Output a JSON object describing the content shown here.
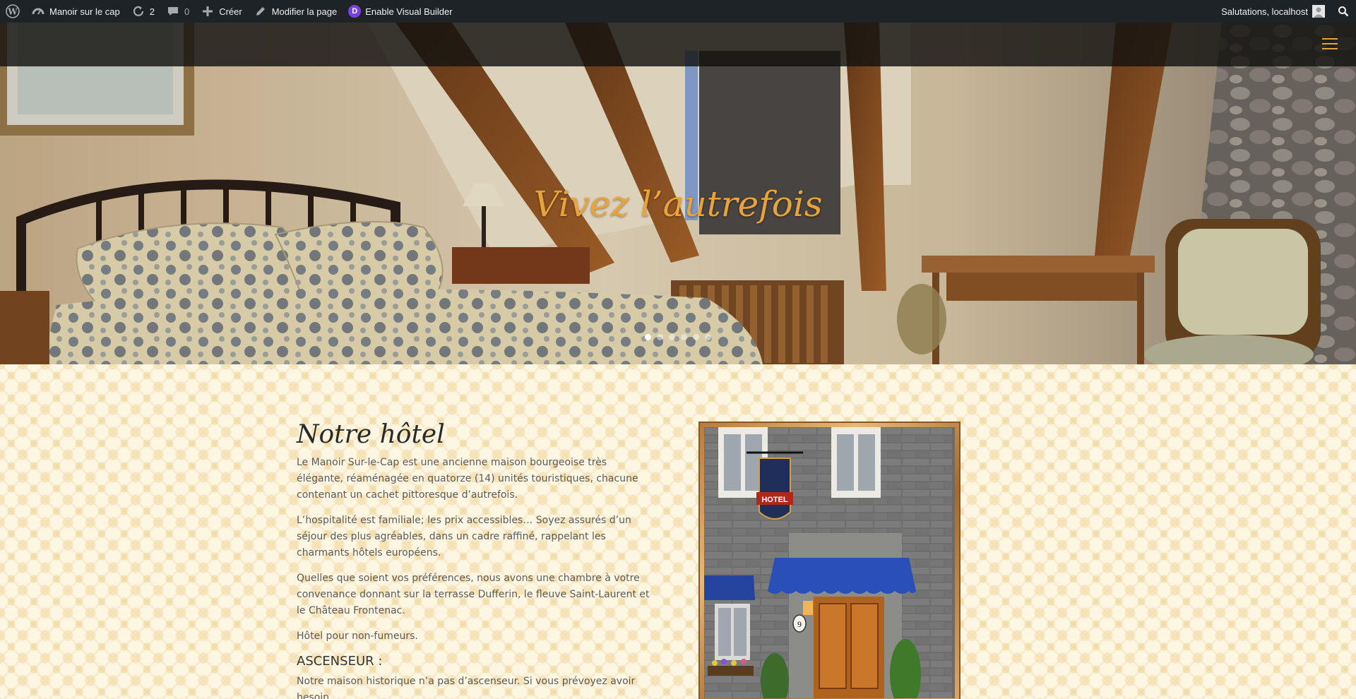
{
  "admin_bar": {
    "site_name": "Manoir sur le cap",
    "updates_count": "2",
    "comments_count": "0",
    "new_label": "Créer",
    "edit_label": "Modifier la page",
    "visual_builder_label": "Enable Visual Builder",
    "greeting": "Salutations, localhost"
  },
  "hero": {
    "title": "Vivez l’autrefois",
    "slides_total": 6,
    "active_slide": 1
  },
  "main": {
    "heading": "Notre hôtel",
    "paragraphs": [
      "Le Manoir Sur-le-Cap est une ancienne maison bourgeoise très élégante, réaménagée en quatorze (14) unités touristiques, chacune contenant un cachet pittoresque d’autrefois.",
      "L’hospitalité est familiale; les prix accessibles… Soyez assurés d’un séjour des plus agréables, dans un cadre raffiné, rappelant les charmants hôtels européens.",
      "Quelles que soient vos préférences, nous avons une chambre à votre convenance donnant sur la terrasse Dufferin, le fleuve Saint-Laurent et le Château Frontenac.",
      "Hôtel pour non-fumeurs."
    ],
    "subheading": "ASCENSEUR :",
    "last_paragraph": "Notre maison historique n’a pas d’ascenseur. Si vous prévoyez avoir besoin",
    "photo": {
      "sign_text": "HOTEL",
      "door_number": "9"
    }
  },
  "colors": {
    "admin_bar_bg": "#1d2327",
    "accent_gold": "#e9a33b",
    "nav_bg": "#141210",
    "page_bg": "#fdf6e3",
    "awning_blue": "#2a4fb8"
  },
  "icons": [
    "wordpress-icon",
    "dashboard-icon",
    "updates-icon",
    "comments-icon",
    "plus-icon",
    "pencil-icon",
    "divi-icon",
    "avatar-icon",
    "search-icon",
    "hamburger-menu-icon"
  ]
}
